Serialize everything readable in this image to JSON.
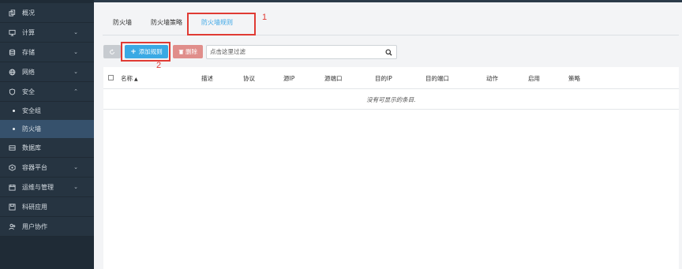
{
  "sidebar": {
    "items": [
      {
        "label": "概况",
        "icon": "copy-icon",
        "expandable": false
      },
      {
        "label": "计算",
        "icon": "monitor-icon",
        "expandable": true,
        "chevron": "⌄"
      },
      {
        "label": "存储",
        "icon": "database-icon",
        "expandable": true,
        "chevron": "⌄"
      },
      {
        "label": "网络",
        "icon": "network-icon",
        "expandable": true,
        "chevron": "⌄"
      },
      {
        "label": "安全",
        "icon": "shield-icon",
        "expandable": true,
        "chevron": "⌃"
      },
      {
        "label": "数据库",
        "icon": "server-icon",
        "expandable": false
      },
      {
        "label": "容器平台",
        "icon": "container-icon",
        "expandable": true,
        "chevron": "⌄"
      },
      {
        "label": "运维与管理",
        "icon": "calendar-icon",
        "expandable": true,
        "chevron": "⌄"
      },
      {
        "label": "科研应用",
        "icon": "save-icon",
        "expandable": false
      },
      {
        "label": "用户协作",
        "icon": "users-icon",
        "expandable": false
      }
    ],
    "security_sub": [
      {
        "label": "安全组",
        "active": false
      },
      {
        "label": "防火墙",
        "active": true
      }
    ]
  },
  "tabs": [
    {
      "label": "防火墙",
      "active": false
    },
    {
      "label": "防火墙策略",
      "active": false
    },
    {
      "label": "防火墙规则",
      "active": true
    }
  ],
  "toolbar": {
    "refresh_icon": "refresh-icon",
    "add_label": "添加规则",
    "delete_label": "删除",
    "search_placeholder": "点击这里过滤"
  },
  "table": {
    "columns": [
      "名称",
      "描述",
      "协议",
      "源IP",
      "源端口",
      "目的IP",
      "目的端口",
      "动作",
      "启用",
      "策略"
    ],
    "sort_indicator": "▲",
    "empty_message": "没有可显示的条目."
  },
  "annotations": {
    "label_1": "1",
    "label_2": "2",
    "color": "#e03b34"
  },
  "colors": {
    "sidebar_bg": "#263441",
    "active_sub_bg": "#36516c",
    "accent": "#3ea7e6",
    "add_button": "#3aa9e4",
    "delete_button": "#e08e8b"
  }
}
